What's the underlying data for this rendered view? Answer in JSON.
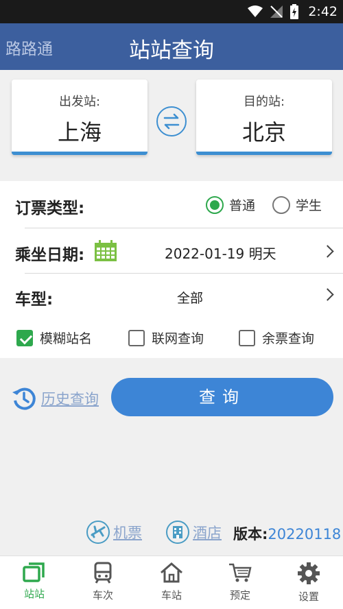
{
  "status_bar": {
    "time": "2:42",
    "icons": [
      "wifi-icon",
      "no-signal-icon",
      "battery-charging-icon"
    ]
  },
  "header": {
    "brand": "路路通",
    "title": "站站查询"
  },
  "stations": {
    "from": {
      "label": "出发站:",
      "name": "上海"
    },
    "to": {
      "label": "目的站:",
      "name": "北京"
    },
    "swap_icon": "swap-arrows-icon"
  },
  "form": {
    "ticket_type": {
      "label": "订票类型:",
      "options": [
        "普通",
        "学生"
      ],
      "selected": "普通"
    },
    "date": {
      "label": "乘坐日期:",
      "value": "2022-01-19 明天",
      "icon": "calendar-icon"
    },
    "train_type": {
      "label": "车型:",
      "value": "全部"
    },
    "checkboxes": [
      {
        "label": "模糊站名",
        "checked": true
      },
      {
        "label": "联网查询",
        "checked": false
      },
      {
        "label": "余票查询",
        "checked": false
      }
    ]
  },
  "actions": {
    "history": "历史查询",
    "query": "查询"
  },
  "footer": {
    "flights": "机票",
    "hotels": "酒店",
    "version_label": "版本:",
    "version": "20220118"
  },
  "tabs": [
    {
      "label": "站站",
      "icon": "station-to-station-icon",
      "active": true
    },
    {
      "label": "车次",
      "icon": "train-icon",
      "active": false
    },
    {
      "label": "车站",
      "icon": "station-house-icon",
      "active": false
    },
    {
      "label": "预定",
      "icon": "cart-icon",
      "active": false
    },
    {
      "label": "设置",
      "icon": "gear-icon",
      "active": false
    }
  ],
  "colors": {
    "appbar": "#3c5f9e",
    "accent_blue": "#3d85d6",
    "accent_green": "#2ea84d",
    "link": "#8aa4cc"
  }
}
